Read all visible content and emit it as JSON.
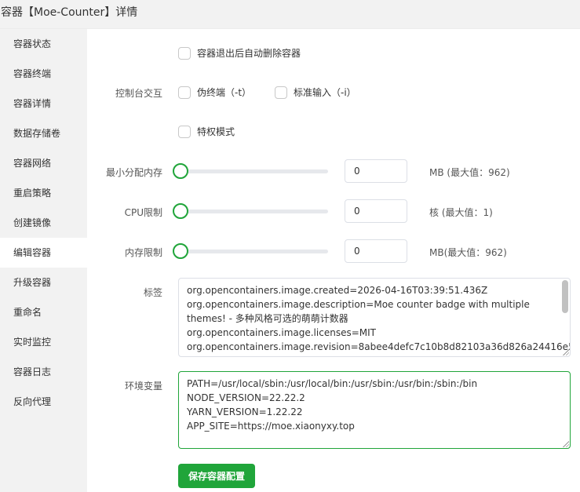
{
  "header": {
    "title": "容器【Moe-Counter】详情"
  },
  "sidebar": {
    "items": [
      {
        "label": "容器状态"
      },
      {
        "label": "容器终端"
      },
      {
        "label": "容器详情"
      },
      {
        "label": "数据存储卷"
      },
      {
        "label": "容器网络"
      },
      {
        "label": "重启策略"
      },
      {
        "label": "创建镜像"
      },
      {
        "label": "编辑容器"
      },
      {
        "label": "升级容器"
      },
      {
        "label": "重命名"
      },
      {
        "label": "实时监控"
      },
      {
        "label": "容器日志"
      },
      {
        "label": "反向代理"
      }
    ],
    "active_index": 7
  },
  "form": {
    "auto_remove": {
      "label": "容器退出后自动删除容器",
      "checked": false
    },
    "console": {
      "label": "控制台交互",
      "tty": {
        "label": "伪终端（-t）",
        "checked": false
      },
      "stdin": {
        "label": "标准输入（-i）",
        "checked": false
      }
    },
    "privileged": {
      "label": "特权模式",
      "checked": false
    },
    "min_memory": {
      "label": "最小分配内存",
      "value": "0",
      "unit": "MB (最大值：962)",
      "fraction": 0
    },
    "cpu_limit": {
      "label": "CPU限制",
      "value": "0",
      "unit": "核 (最大值：1)",
      "fraction": 0
    },
    "mem_limit": {
      "label": "内存限制",
      "value": "0",
      "unit": "MB(最大值：962)",
      "fraction": 0
    },
    "labels": {
      "label": "标签",
      "lines": [
        "org.opencontainers.image.created=2026-04-16T03:39:51.436Z",
        "org.opencontainers.image.description=Moe counter badge with multiple",
        "themes! - 多种风格可选的萌萌计数器",
        "org.opencontainers.image.licenses=MIT",
        "org.opencontainers.image.revision=8abee4defc7c10b8d82103a36d826a24416e5"
      ]
    },
    "env": {
      "label": "环境变量",
      "lines": [
        "PATH=/usr/local/sbin:/usr/local/bin:/usr/sbin:/usr/bin:/sbin:/bin",
        "NODE_VERSION=22.22.2",
        "YARN_VERSION=1.22.22",
        "APP_SITE=https://moe.xiaonyxy.top"
      ]
    },
    "save_label": "保存容器配置"
  },
  "colors": {
    "accent": "#20a53a",
    "sidebar_bg": "#f2f2f2"
  }
}
